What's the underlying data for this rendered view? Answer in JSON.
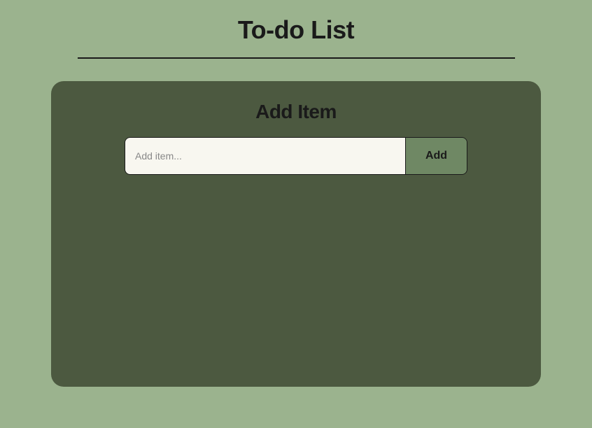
{
  "header": {
    "title": "To-do List"
  },
  "card": {
    "section_title": "Add Item",
    "input": {
      "placeholder": "Add item...",
      "value": ""
    },
    "add_button_label": "Add"
  }
}
